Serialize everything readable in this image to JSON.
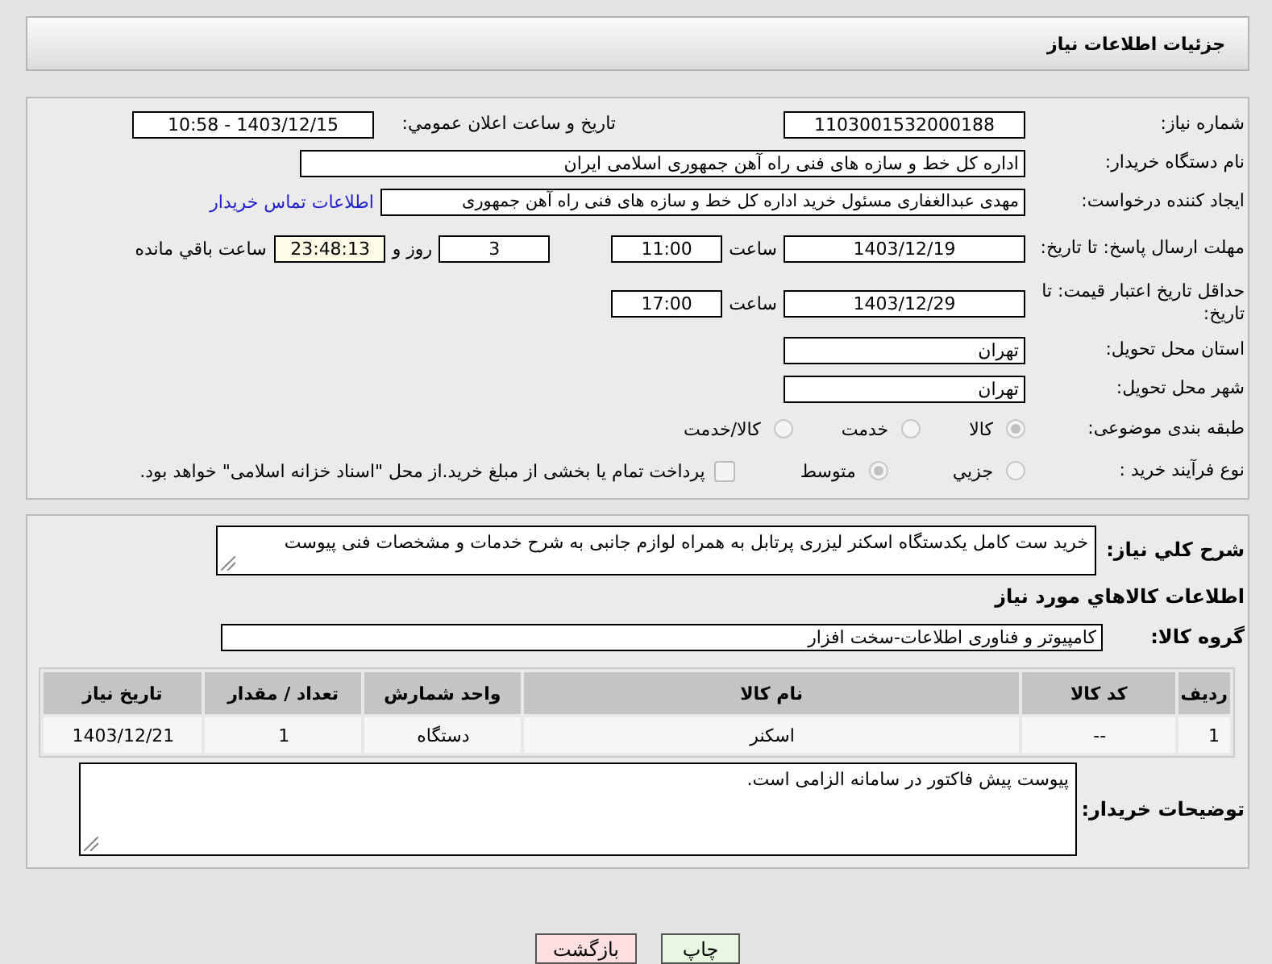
{
  "header": {
    "title": "جزئیات اطلاعات نیاز"
  },
  "need_number": {
    "label": "شماره نیاز:",
    "value": "1103001532000188"
  },
  "announce": {
    "label": "تاریخ و ساعت اعلان عمومي:",
    "value": "1403/12/15 - 10:58"
  },
  "buyer_org": {
    "label": "نام دستگاه خریدار:",
    "value": "اداره کل خط و سازه های فنی راه آهن جمهوری اسلامی ایران"
  },
  "requester": {
    "label": "ایجاد کننده درخواست:",
    "value": "مهدی عبدالغفاری مسئول خرید اداره کل خط و سازه های فنی راه آهن جمهوری",
    "link": "اطلاعات تماس خریدار"
  },
  "deadline": {
    "label": "مهلت ارسال پاسخ: تا تاریخ:",
    "date": "1403/12/19",
    "time_label": "ساعت",
    "time": "11:00",
    "days": "3",
    "days_label": "روز و",
    "remaining": "23:48:13",
    "remaining_label": "ساعت باقي مانده"
  },
  "price_validity": {
    "label": "حداقل تاریخ اعتبار قیمت: تا تاریخ:",
    "date": "1403/12/29",
    "time_label": "ساعت",
    "time": "17:00"
  },
  "province": {
    "label": "استان محل تحویل:",
    "value": "تهران"
  },
  "city": {
    "label": "شهر محل تحویل:",
    "value": "تهران"
  },
  "category": {
    "label": "طبقه بندی موضوعی:",
    "options": [
      {
        "label": "کالا",
        "selected": true
      },
      {
        "label": "خدمت",
        "selected": false
      },
      {
        "label": "کالا/خدمت",
        "selected": false
      }
    ]
  },
  "process": {
    "label": "نوع فرآیند خرید :",
    "options": [
      {
        "label": "جزیي",
        "selected": false
      },
      {
        "label": "متوسط",
        "selected": true
      }
    ],
    "treasury": {
      "label": "پرداخت تمام یا بخشی از مبلغ خرید.از محل \"اسناد خزانه اسلامی\" خواهد بود.",
      "checked": false
    }
  },
  "summary": {
    "label": "شرح کلي نیاز:",
    "value": "خرید ست کامل یکدستگاه اسکنر لیزری پرتابل به همراه لوازم جانبی به شرح خدمات و مشخصات فنی پیوست"
  },
  "items_title": "اطلاعات کالاهاي مورد نیاز",
  "goods_group": {
    "label": "گروه کالا:",
    "value": "کامپیوتر و فناوری اطلاعات-سخت افزار"
  },
  "table": {
    "columns": [
      "ردیف",
      "کد کالا",
      "نام کالا",
      "واحد شمارش",
      "تعداد / مقدار",
      "تاریخ نیاز"
    ],
    "rows": [
      [
        "1",
        "--",
        "اسکنر",
        "دستگاه",
        "1",
        "1403/12/21"
      ]
    ]
  },
  "buyer_notes": {
    "label": "توضیحات خریدار:",
    "value": "پیوست پیش فاکتور در سامانه الزامی است."
  },
  "buttons": [
    {
      "label": "چاپ",
      "kind": "print"
    },
    {
      "label": "بازگشت",
      "kind": "back"
    }
  ]
}
